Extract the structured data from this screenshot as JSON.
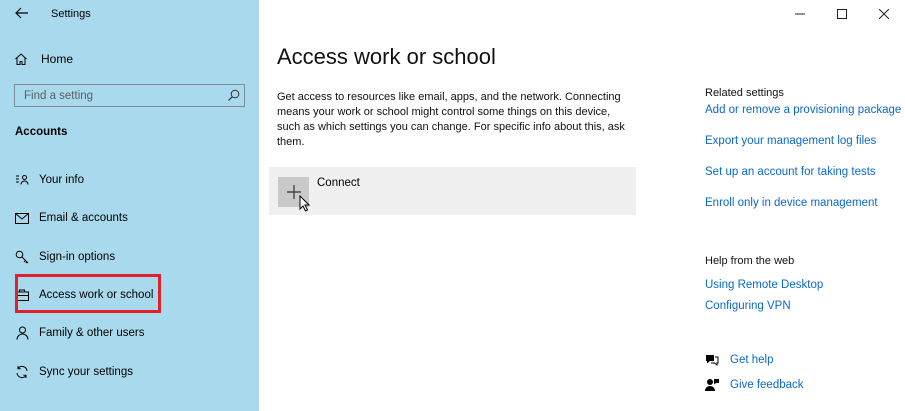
{
  "app": {
    "title": "Settings"
  },
  "window_controls": {
    "minimize": "—",
    "maximize": "☐",
    "close": "✕"
  },
  "sidebar": {
    "home_label": "Home",
    "search_placeholder": "Find a setting",
    "section_heading": "Accounts",
    "items": [
      {
        "label": "Your info",
        "icon": "person-info-icon"
      },
      {
        "label": "Email & accounts",
        "icon": "mail-icon"
      },
      {
        "label": "Sign-in options",
        "icon": "key-icon"
      },
      {
        "label": "Access work or school",
        "icon": "briefcase-icon"
      },
      {
        "label": "Family & other users",
        "icon": "person-icon"
      },
      {
        "label": "Sync your settings",
        "icon": "sync-icon"
      }
    ],
    "selected_item": "Access work or school",
    "highlight_color": "#e0202a"
  },
  "main": {
    "title": "Access work or school",
    "description": "Get access to resources like email, apps, and the network. Connecting means your work or school might control some things on this device, such as which settings you can change. For specific info about this, ask them.",
    "connect_label": "Connect"
  },
  "related": {
    "heading": "Related settings",
    "links": [
      "Add or remove a provisioning package",
      "Export your management log files",
      "Set up an account for taking tests",
      "Enroll only in device management"
    ]
  },
  "help": {
    "heading": "Help from the web",
    "links": [
      "Using Remote Desktop",
      "Configuring VPN"
    ]
  },
  "feedback": {
    "get_help": "Get help",
    "give_feedback": "Give feedback"
  },
  "colors": {
    "sidebar_bg": "#a9d9ec",
    "link": "#0b69c7",
    "connect_bg": "#f0f0f0"
  }
}
